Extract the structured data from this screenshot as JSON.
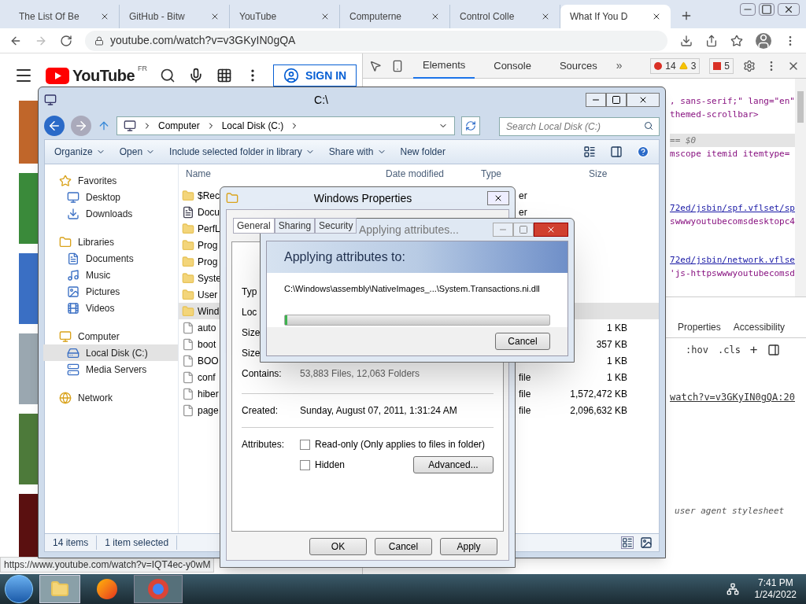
{
  "browser": {
    "tabs": [
      {
        "label": "The List Of Be",
        "selected": false
      },
      {
        "label": "GitHub - Bitw",
        "selected": false
      },
      {
        "label": "YouTube",
        "selected": false
      },
      {
        "label": "Computerne",
        "selected": false
      },
      {
        "label": "Control Colle",
        "selected": false
      },
      {
        "label": "What If You D",
        "selected": true
      }
    ],
    "address": "youtube.com/watch?v=v3GKyIN0gQA",
    "status_url": "https://www.youtube.com/watch?v=IQT4ec-y0wM"
  },
  "youtube": {
    "logo": "YouTube",
    "region": "FR",
    "sign_in": "SIGN IN"
  },
  "devtools": {
    "tabs": [
      {
        "label": "Elements",
        "selected": true
      },
      {
        "label": "Console",
        "selected": false
      },
      {
        "label": "Sources",
        "selected": false
      }
    ],
    "more": "»",
    "errors": "14",
    "warnings": "3",
    "issues": "5",
    "code_lines": [
      {
        "text": ", sans-serif;\" lang=\"en\"",
        "kind": "code"
      },
      {
        "text": "themed-scrollbar>",
        "kind": "code"
      },
      {
        "text": "== $0",
        "kind": "selected"
      },
      {
        "text": "mscope itemid itemtype=",
        "kind": "code"
      },
      {
        "text": "72ed/jsbin/spf.vflset/sp",
        "kind": "link"
      },
      {
        "text": "swwwyoutubecomsdesktopc4",
        "kind": "code"
      },
      {
        "text": "72ed/jsbin/network.vflse",
        "kind": "link"
      },
      {
        "text": "'js-httpswwwyoutubecomsd",
        "kind": "code"
      }
    ],
    "lower_tabs": [
      "Properties",
      "Accessibility"
    ],
    "hov": ":hov",
    "cls": ".cls",
    "plus": "+",
    "source_link": "watch?v=v3GKyIN0gQA:20",
    "stylesheet": "user agent stylesheet"
  },
  "explorer": {
    "title": "C:\\",
    "breadcrumb": [
      "Computer",
      "Local Disk (C:)"
    ],
    "search_placeholder": "Search Local Disk (C:)",
    "toolbar": [
      {
        "label": "Organize",
        "dropdown": true
      },
      {
        "label": "Open",
        "dropdown": true
      },
      {
        "label": "Include selected folder in library",
        "dropdown": true
      },
      {
        "label": "Share with",
        "dropdown": true
      },
      {
        "label": "New folder",
        "dropdown": false
      }
    ],
    "sidebar": [
      {
        "label": "Favorites",
        "selected": false,
        "children": [
          {
            "label": "Desktop",
            "selected": false
          },
          {
            "label": "Downloads",
            "selected": false
          }
        ]
      },
      {
        "label": "Libraries",
        "selected": false,
        "children": [
          {
            "label": "Documents",
            "selected": false
          },
          {
            "label": "Music",
            "selected": false
          },
          {
            "label": "Pictures",
            "selected": false
          },
          {
            "label": "Videos",
            "selected": false
          }
        ]
      },
      {
        "label": "Computer",
        "selected": false,
        "children": [
          {
            "label": "Local Disk (C:)",
            "selected": true
          },
          {
            "label": "Media Servers",
            "selected": false
          }
        ]
      },
      {
        "label": "Network",
        "selected": false
      }
    ],
    "columns": [
      "Name",
      "Date modified",
      "Type",
      "Size"
    ],
    "rows": [
      {
        "name": "$Rec",
        "kind": "folder",
        "type": "er",
        "size": null,
        "selected": false
      },
      {
        "name": "Docu",
        "kind": "shortcut",
        "type": "er",
        "size": null,
        "selected": false
      },
      {
        "name": "PerfL",
        "kind": "folder",
        "type": null,
        "size": null,
        "selected": false
      },
      {
        "name": "Prog",
        "kind": "folder",
        "type": null,
        "size": null,
        "selected": false
      },
      {
        "name": "Prog",
        "kind": "folder",
        "type": null,
        "size": null,
        "selected": false
      },
      {
        "name": "Syste",
        "kind": "folder",
        "type": null,
        "size": null,
        "selected": false
      },
      {
        "name": "User",
        "kind": "folder",
        "type": null,
        "size": null,
        "selected": false
      },
      {
        "name": "Wind",
        "kind": "folder",
        "type": null,
        "size": null,
        "selected": true
      },
      {
        "name": "auto",
        "kind": "file",
        "type": null,
        "size": "1 KB",
        "selected": false
      },
      {
        "name": "boot",
        "kind": "file",
        "type": null,
        "size": "357 KB",
        "selected": false
      },
      {
        "name": "BOO",
        "kind": "file",
        "type": null,
        "size": "1 KB",
        "selected": false
      },
      {
        "name": "conf",
        "kind": "file",
        "type": "file",
        "size": "1 KB",
        "selected": false
      },
      {
        "name": "hiber",
        "kind": "file",
        "type": "file",
        "size": "1,572,472 KB",
        "selected": false
      },
      {
        "name": "page",
        "kind": "file",
        "type": "file",
        "size": "2,096,632 KB",
        "selected": false
      }
    ],
    "status": [
      "14 items",
      "1 item selected"
    ]
  },
  "properties": {
    "title": "Windows Properties",
    "tabs": [
      {
        "label": "General",
        "selected": true
      },
      {
        "label": "Sharing",
        "selected": false
      },
      {
        "label": "Security",
        "selected": false
      }
    ],
    "labels": [
      "Typ",
      "Loc",
      "Size",
      "Size"
    ],
    "contains_label": "Contains:",
    "contains_value": "53,883 Files, 12,063 Folders",
    "created_label": "Created:",
    "created_value": "Sunday, August 07, 2011, 1:31:24 AM",
    "attributes_label": "Attributes:",
    "attributes": [
      {
        "label": "Read-only (Only applies to files in folder)",
        "checked": false
      },
      {
        "label": "Hidden",
        "checked": false
      }
    ],
    "advanced": "Advanced...",
    "buttons": [
      "OK",
      "Cancel",
      "Apply"
    ]
  },
  "progress": {
    "title": "Applying attributes...",
    "heading": "Applying attributes to:",
    "path": "C:\\Windows\\assembly\\NativeImages_...\\System.Transactions.ni.dll",
    "level": 0.01,
    "cancel": "Cancel"
  },
  "taskbar": {
    "time": "7:41 PM",
    "date": "1/24/2022"
  }
}
